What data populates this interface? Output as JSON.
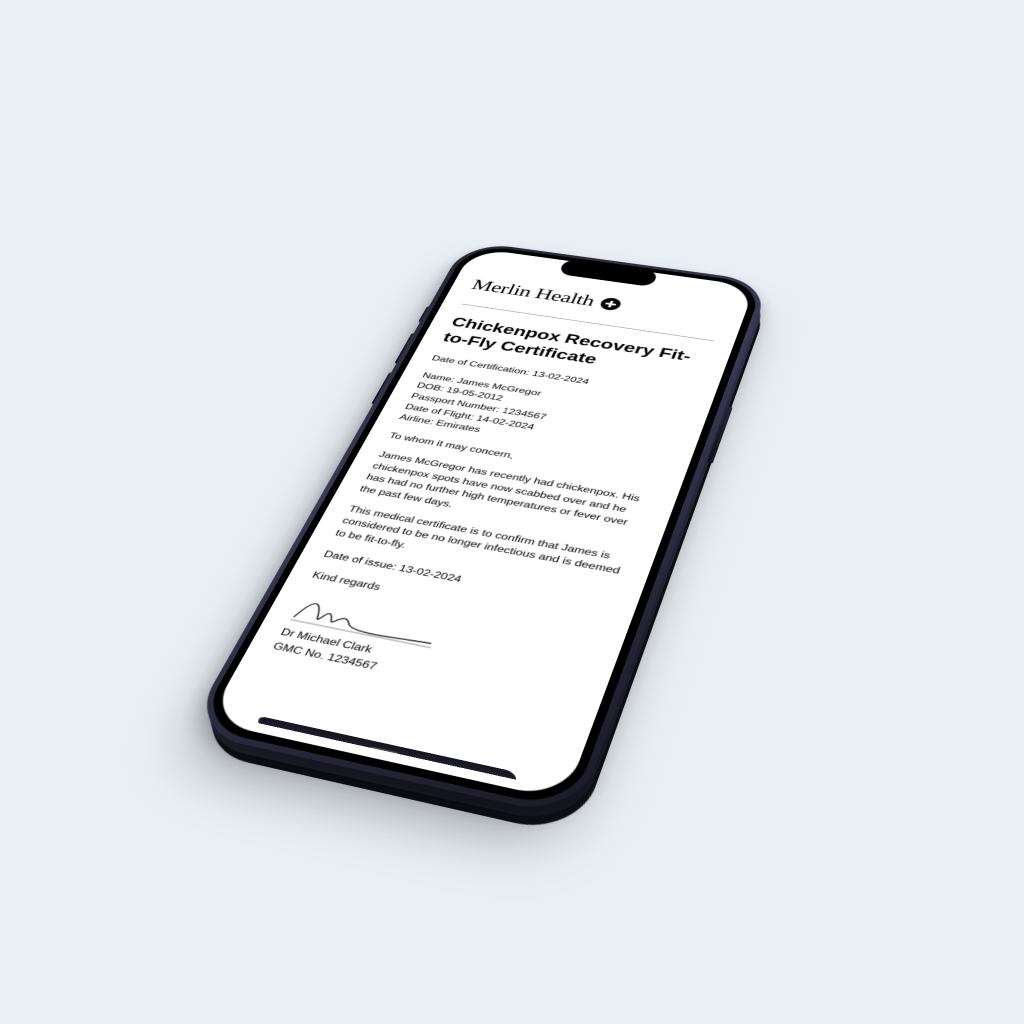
{
  "brand": {
    "name": "Merlin Health",
    "icon": "plus-circle-icon"
  },
  "document": {
    "title": "Chickenpox Recovery Fit-to-Fly Certificate",
    "cert_date_label": "Date of Certification:",
    "cert_date": "13-02-2024",
    "patient": {
      "name_label": "Name:",
      "name": "James McGregor",
      "dob_label": "DOB:",
      "dob": "19-05-2012",
      "passport_label": "Passport Number:",
      "passport": "1234567",
      "flight_date_label": "Date of Flight:",
      "flight_date": "14-02-2024",
      "airline_label": "Airline:",
      "airline": "Emirates"
    },
    "salutation": "To whom it may concern,",
    "para1": "James McGregor has recently had chickenpox. His chickenpox spots have now scabbed over and he has had no further high temperatures or fever over the past few days.",
    "para2": "This medical certificate is to confirm that James is considered to be no longer infectious and is deemed to be fit-to-fly.",
    "issue_label": "Date of issue:",
    "issue_date": "13-02-2024",
    "closing": "Kind regards",
    "doctor": {
      "name": "Dr Michael Clark",
      "gmc_label": "GMC No.",
      "gmc": "1234567"
    }
  }
}
